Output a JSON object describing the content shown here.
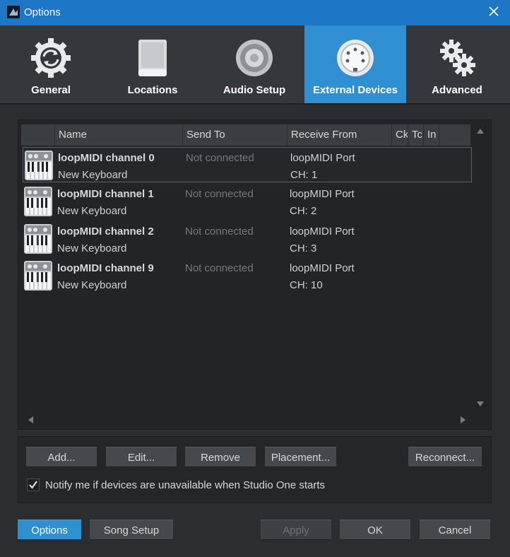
{
  "window": {
    "title": "Options"
  },
  "tabs": [
    {
      "label": "General",
      "icon": "sync-gear-icon"
    },
    {
      "label": "Locations",
      "icon": "drive-icon"
    },
    {
      "label": "Audio Setup",
      "icon": "speaker-icon"
    },
    {
      "label": "External Devices",
      "icon": "midi-port-icon",
      "active": true
    },
    {
      "label": "Advanced",
      "icon": "gears-icon"
    }
  ],
  "table": {
    "columns": [
      "Name",
      "Send To",
      "Receive From",
      "Ck",
      "Tc",
      "In"
    ],
    "rows": [
      {
        "name": "loopMIDI channel 0",
        "model": "New Keyboard",
        "send_to": "Not connected",
        "receive_from": "loopMIDI Port",
        "channel": "CH: 1"
      },
      {
        "name": "loopMIDI channel 1",
        "model": "New Keyboard",
        "send_to": "Not connected",
        "receive_from": "loopMIDI Port",
        "channel": "CH: 2"
      },
      {
        "name": "loopMIDI channel 2",
        "model": "New Keyboard",
        "send_to": "Not connected",
        "receive_from": "loopMIDI Port",
        "channel": "CH: 3"
      },
      {
        "name": "loopMIDI channel 9",
        "model": "New Keyboard",
        "send_to": "Not connected",
        "receive_from": "loopMIDI Port",
        "channel": "CH: 10"
      }
    ]
  },
  "actions": {
    "add": "Add...",
    "edit": "Edit...",
    "remove": "Remove",
    "placement": "Placement...",
    "reconnect": "Reconnect..."
  },
  "notify": {
    "label": "Notify me if devices are unavailable when Studio One starts",
    "checked": true
  },
  "footer": {
    "options": "Options",
    "song_setup": "Song Setup",
    "apply": "Apply",
    "ok": "OK",
    "cancel": "Cancel"
  },
  "colors": {
    "accent": "#2f8fd0",
    "titlebar": "#1d76c6",
    "background": "#2b2d30"
  }
}
